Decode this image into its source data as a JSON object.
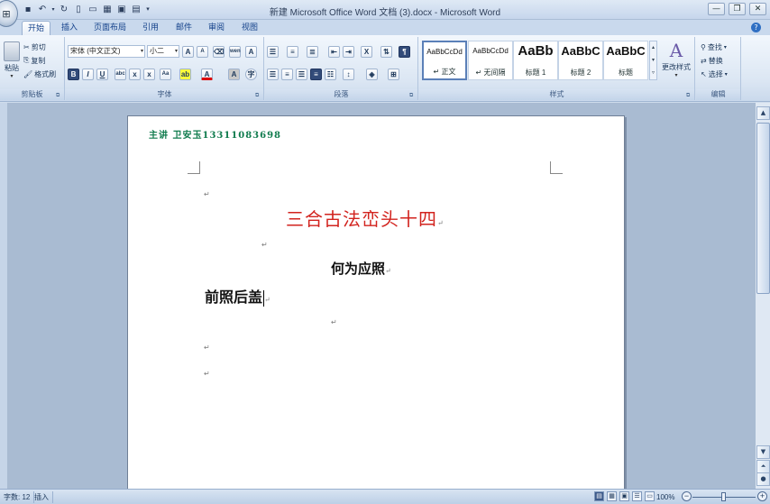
{
  "app": {
    "title": "新建 Microsoft Office Word 文档 (3).docx - Microsoft Word",
    "office_button": "Office"
  },
  "qat": {
    "save": "save-icon",
    "undo": "undo-icon",
    "redo": "redo-icon"
  },
  "tabs": [
    {
      "label": "开始",
      "active": true
    },
    {
      "label": "插入"
    },
    {
      "label": "页面布局"
    },
    {
      "label": "引用"
    },
    {
      "label": "邮件"
    },
    {
      "label": "审阅"
    },
    {
      "label": "视图"
    }
  ],
  "ribbon": {
    "clipboard": {
      "paste": "粘贴",
      "cut": "剪切",
      "copy": "复制",
      "format_painter": "格式刷",
      "label": "剪贴板"
    },
    "font": {
      "font_name": "宋体 (中文正文)",
      "font_size": "小二",
      "label": "字体"
    },
    "paragraph": {
      "label": "段落"
    },
    "styles": {
      "label": "样式",
      "items": [
        {
          "sample": "AaBbCcDd",
          "name": "↵ 正文"
        },
        {
          "sample": "AaBbCcDd",
          "name": "↵ 无间隔"
        },
        {
          "sample": "AaBb",
          "name": "标题 1"
        },
        {
          "sample": "AaBbC",
          "name": "标题 2"
        },
        {
          "sample": "AaBbC",
          "name": "标题"
        }
      ],
      "change_styles": "更改样式"
    },
    "editing": {
      "find": "查找",
      "replace": "替换",
      "select": "选择",
      "label": "编辑"
    }
  },
  "document": {
    "header": "主讲 卫安玉13311083698",
    "title": "三合古法峦头十四",
    "subtitle": "何为应照",
    "line1": "前照后盖",
    "pilcrow": "↵"
  },
  "status": {
    "word_count": "字数: 12",
    "mode": "插入",
    "zoom": "100%"
  }
}
